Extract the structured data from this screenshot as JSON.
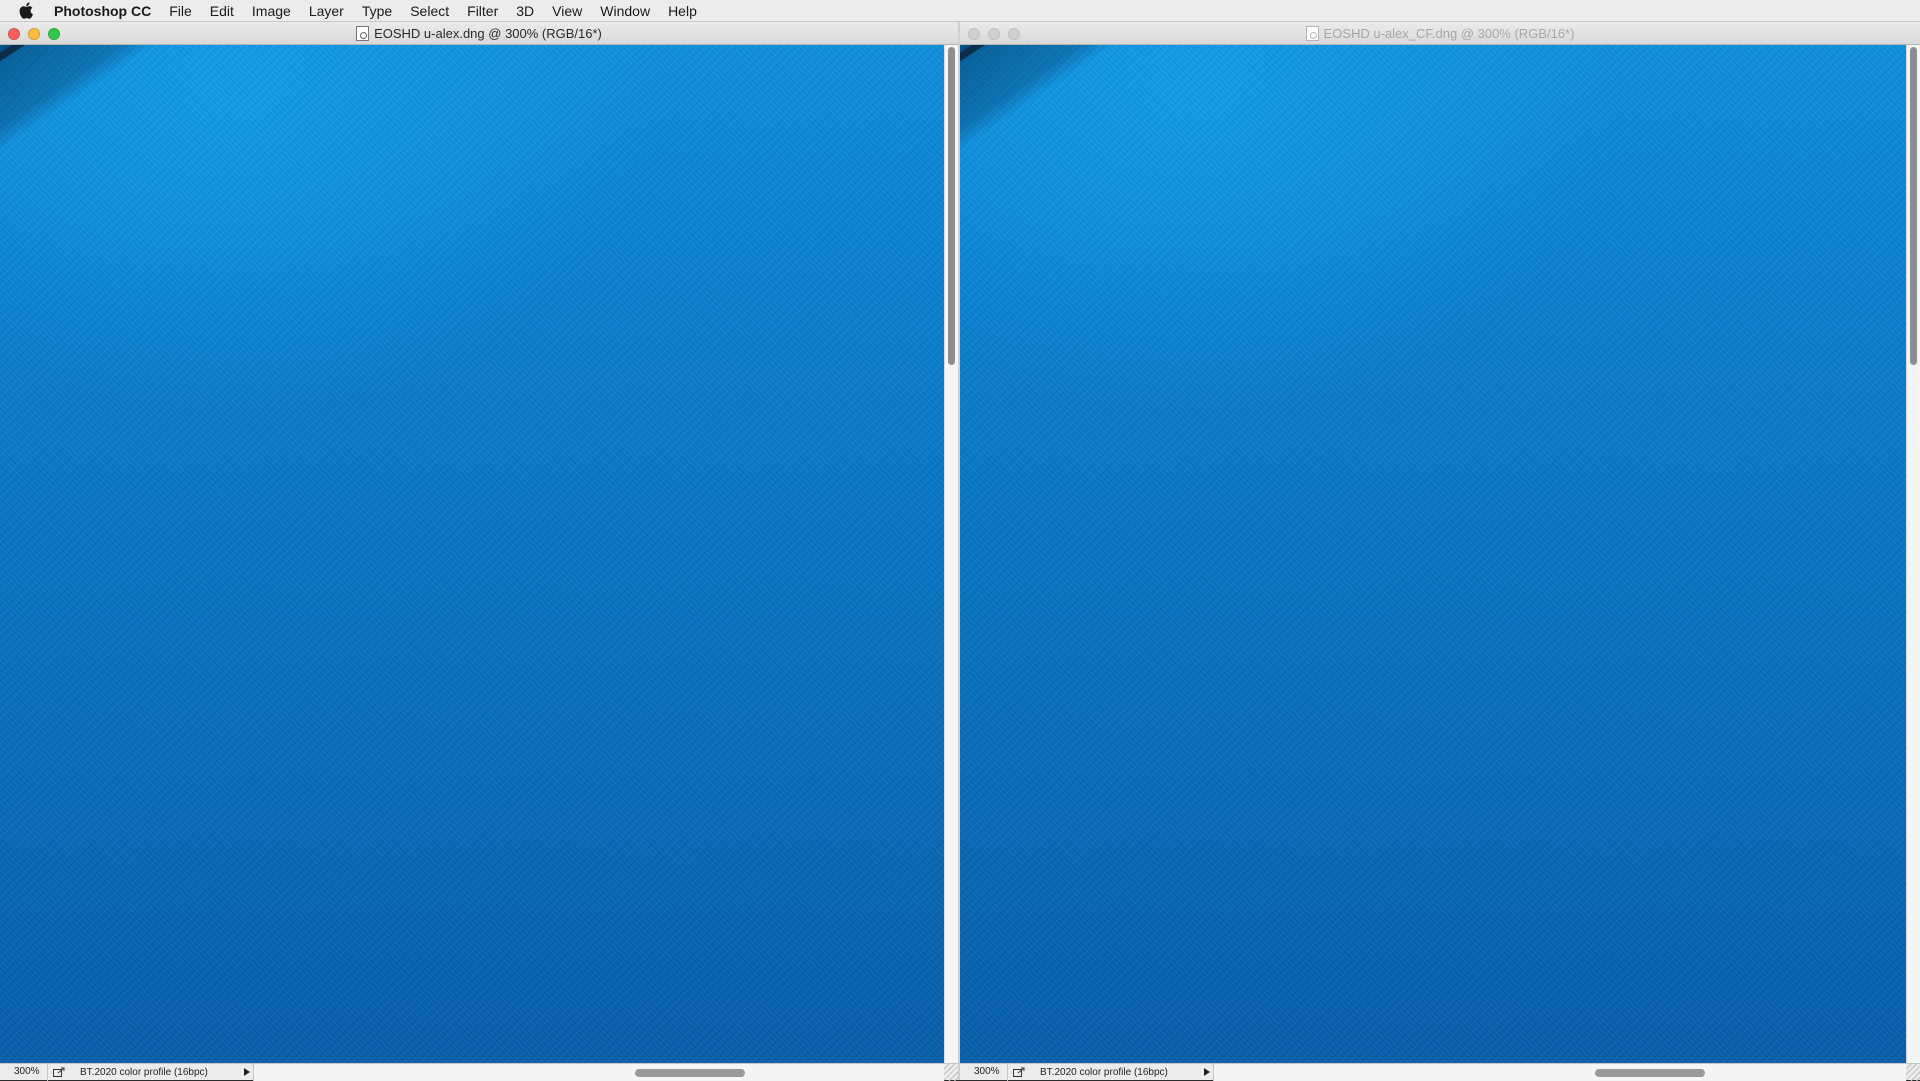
{
  "menubar": {
    "apple_icon": "apple-logo-icon",
    "app_name": "Photoshop CC",
    "items": [
      "File",
      "Edit",
      "Image",
      "Layer",
      "Type",
      "Select",
      "Filter",
      "3D",
      "View",
      "Window",
      "Help"
    ]
  },
  "windows": [
    {
      "title": "EOSHD u-alex.dng @ 300% (RGB/16*)",
      "active": true,
      "zoom": "300%",
      "profile": "BT.2020 color profile (16bpc)"
    },
    {
      "title": "EOSHD u-alex_CF.dng @ 300% (RGB/16*)",
      "active": false,
      "zoom": "300%",
      "profile": "BT.2020 color profile (16bpc)"
    }
  ],
  "colors": {
    "canvas_blue": "#0873c2",
    "close_red": "#fc605c",
    "minimize_yellow": "#fdbc40",
    "maximize_green": "#34c84a"
  }
}
